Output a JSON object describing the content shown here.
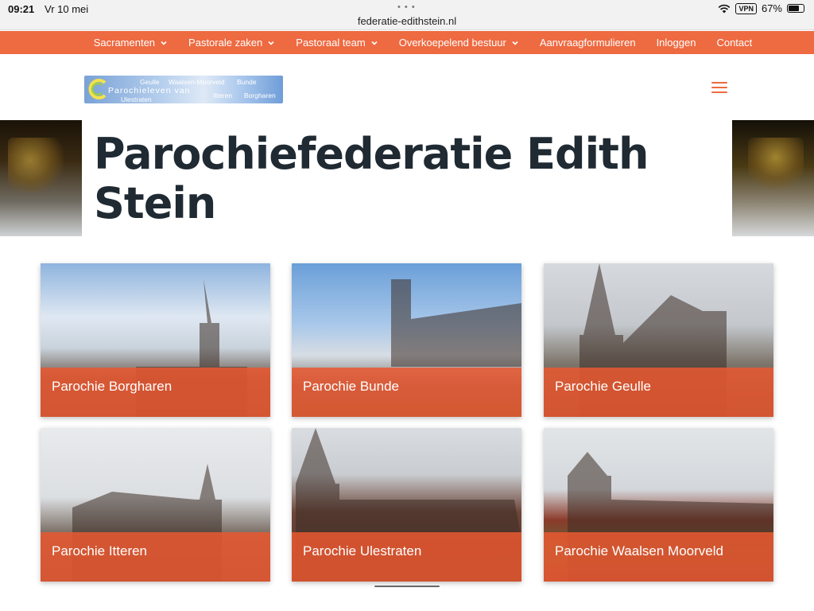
{
  "status_bar": {
    "time": "09:21",
    "date": "Vr 10 mei",
    "url": "federatie-edithstein.nl",
    "vpn": "VPN",
    "battery": "67%",
    "battery_level": 0.67
  },
  "nav": {
    "items": [
      {
        "label": "Sacramenten",
        "dropdown": true
      },
      {
        "label": "Pastorale zaken",
        "dropdown": true
      },
      {
        "label": "Pastoraal team",
        "dropdown": true
      },
      {
        "label": "Overkoepelend bestuur",
        "dropdown": true
      },
      {
        "label": "Aanvraagformulieren",
        "dropdown": false
      },
      {
        "label": "Inloggen",
        "dropdown": false
      },
      {
        "label": "Contact",
        "dropdown": false
      }
    ],
    "color": "#ee6a41"
  },
  "logo": {
    "words": [
      "Geulle",
      "Waalsen-Moorveld",
      "Bunde",
      "Parochieleven van",
      "Ulestraten",
      "Itteren",
      "Borgharen"
    ]
  },
  "hero": {
    "title": "Parochiefederatie Edith Stein"
  },
  "tiles": [
    {
      "label": "Parochie Borgharen"
    },
    {
      "label": "Parochie Bunde"
    },
    {
      "label": "Parochie Geulle"
    },
    {
      "label": "Parochie Itteren"
    },
    {
      "label": "Parochie Ulestraten"
    },
    {
      "label": "Parochie Waalsen Moorveld"
    }
  ],
  "icons": {
    "wifi": "wifi-icon",
    "battery": "battery-icon",
    "chevron": "chevron-down-icon",
    "menu": "hamburger-menu-icon"
  },
  "colors": {
    "accent": "#ee6a41",
    "tile_band": "#ea5830",
    "title": "#1f2a33"
  }
}
